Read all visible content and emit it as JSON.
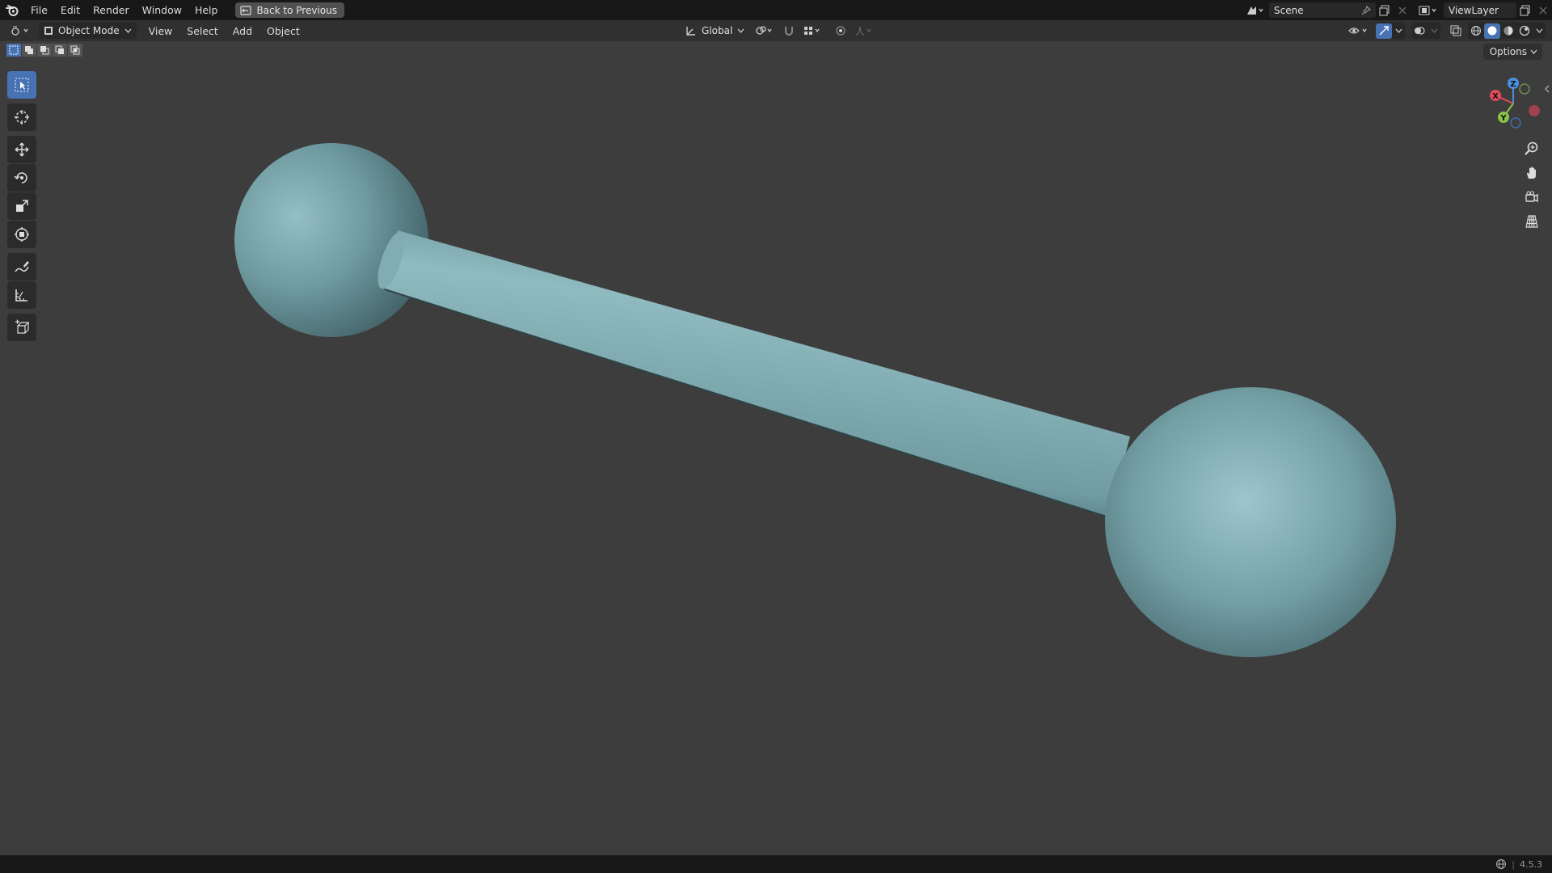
{
  "menu": {
    "items": [
      "File",
      "Edit",
      "Render",
      "Window",
      "Help"
    ],
    "back_button": "Back to Previous"
  },
  "topbar_right": {
    "scene": "Scene",
    "view_layer": "ViewLayer"
  },
  "header": {
    "mode": "Object Mode",
    "menus": [
      "View",
      "Select",
      "Add",
      "Object"
    ],
    "orientation": "Global",
    "options": "Options"
  },
  "toolbar": {
    "tools": [
      "select-box",
      "cursor",
      "move",
      "rotate",
      "scale",
      "transform",
      "annotate",
      "measure",
      "add-cube"
    ],
    "active": "select-box"
  },
  "gizmo": {
    "axes": [
      "X",
      "Y",
      "Z"
    ],
    "colors": {
      "x": "#e34b5a",
      "y": "#8bc34a",
      "z": "#4a90e2"
    }
  },
  "status": {
    "version": "4.5.3"
  },
  "colors": {
    "accent": "#4772b3",
    "mesh": "#6e9aa0"
  }
}
